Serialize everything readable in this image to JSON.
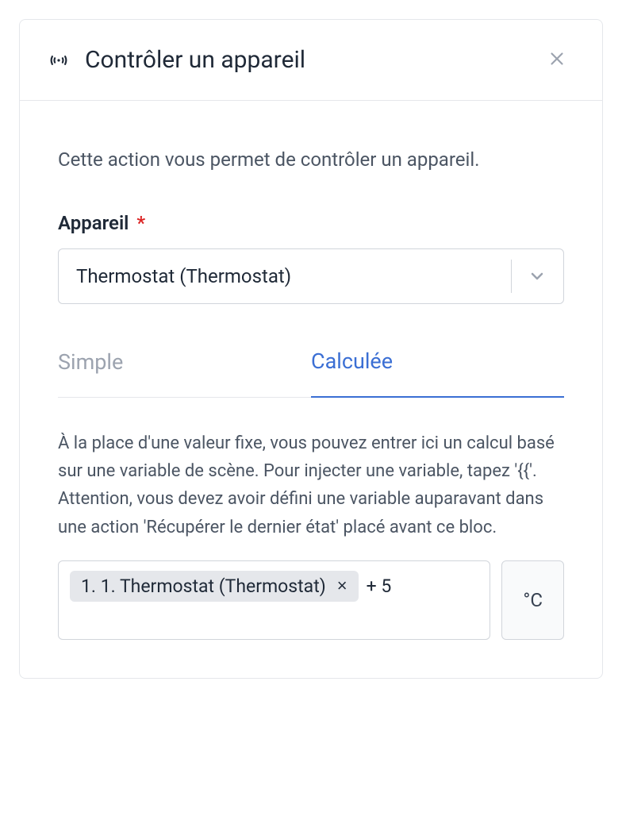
{
  "header": {
    "title": "Contrôler un appareil"
  },
  "body": {
    "description": "Cette action vous permet de contrôler un appareil.",
    "device_label": "Appareil",
    "required_mark": "*",
    "device_value": "Thermostat (Thermostat)"
  },
  "tabs": {
    "simple": "Simple",
    "calculated": "Calculée"
  },
  "calc": {
    "help": "À la place d'une valeur fixe, vous pouvez entrer ici un calcul basé sur une variable de scène. Pour injecter une variable, tapez '{{'. Attention, vous devez avoir défini une variable auparavant dans une action 'Récupérer le dernier état' placé avant ce bloc.",
    "chip_label": "1. 1. Thermostat (Thermostat)",
    "expr_tail": "+ 5",
    "unit": "°C"
  }
}
